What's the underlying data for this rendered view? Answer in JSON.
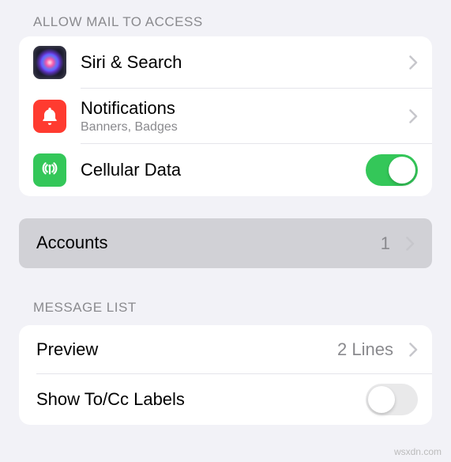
{
  "sections": {
    "allow_access_header": "ALLOW MAIL TO ACCESS",
    "message_list_header": "MESSAGE LIST"
  },
  "access": {
    "siri_label": "Siri & Search",
    "notifications_label": "Notifications",
    "notifications_sub": "Banners, Badges",
    "cellular_label": "Cellular Data",
    "cellular_on": true
  },
  "accounts": {
    "label": "Accounts",
    "count": "1"
  },
  "message_list": {
    "preview_label": "Preview",
    "preview_value": "2 Lines",
    "show_tocc_label": "Show To/Cc Labels",
    "show_tocc_on": false
  },
  "watermark": "wsxdn.com",
  "colors": {
    "bg": "#f2f2f7",
    "card": "#ffffff",
    "green": "#34c759",
    "red": "#ff3b30",
    "grey_text": "#8a8a8e"
  }
}
